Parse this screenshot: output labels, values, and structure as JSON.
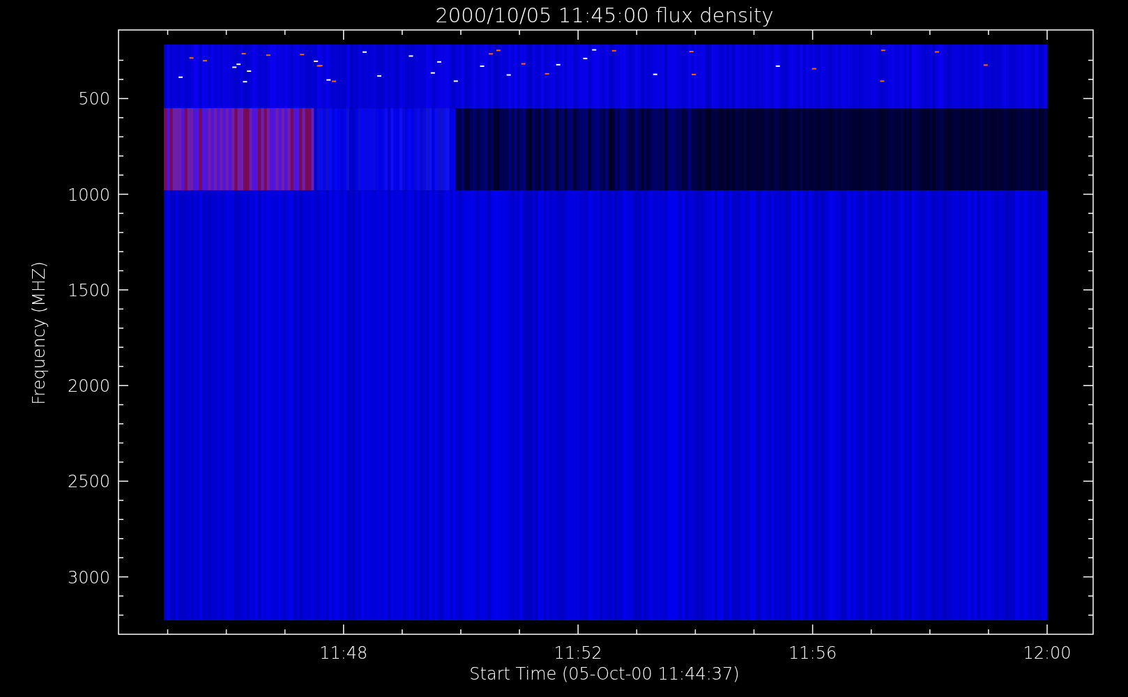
{
  "title": "2000/10/05 11:45:00 flux density",
  "y_axis": {
    "label": "Frequency (MHZ)",
    "ticks": [
      "500",
      "1000",
      "1500",
      "2000",
      "2500",
      "3000"
    ]
  },
  "x_axis": {
    "label": "Start Time (05-Oct-00 11:44:37)",
    "ticks": [
      "11:48",
      "11:52",
      "11:56",
      "12:00"
    ]
  }
}
